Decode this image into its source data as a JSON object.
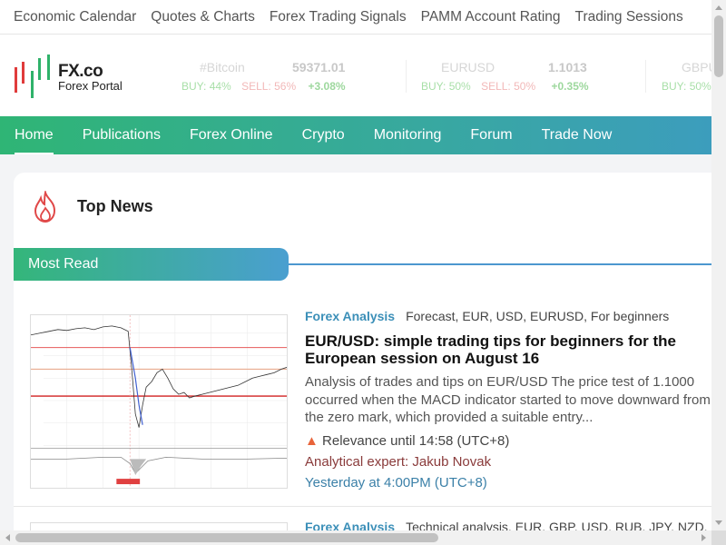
{
  "topnav": {
    "items": [
      "Economic Calendar",
      "Quotes & Charts",
      "Forex Trading Signals",
      "PAMM Account Rating",
      "Trading Sessions"
    ]
  },
  "logo": {
    "name": "FX.co",
    "tagline": "Forex Portal"
  },
  "tickers": [
    {
      "symbol": "#Bitcoin",
      "price": "59371.01",
      "buy_label": "BUY:",
      "buy": "44%",
      "sell_label": "SELL:",
      "sell": "56%",
      "change": "+3.08%"
    },
    {
      "symbol": "EURUSD",
      "price": "1.1013",
      "buy_label": "BUY:",
      "buy": "50%",
      "sell_label": "SELL:",
      "sell": "50%",
      "change": "+0.35%"
    },
    {
      "symbol": "GBPU",
      "price": "",
      "buy_label": "BUY:",
      "buy": "50%",
      "sell_label": "",
      "sell": "",
      "change": ""
    }
  ],
  "mainnav": {
    "items": [
      "Home",
      "Publications",
      "Forex Online",
      "Crypto",
      "Monitoring",
      "Forum",
      "Trade Now"
    ],
    "active": "Home"
  },
  "section": {
    "title": "Top News",
    "tab": "Most Read"
  },
  "articles": [
    {
      "category": "Forex Analysis",
      "tags": "Forecast, EUR, USD, EURUSD, For beginners",
      "headline": "EUR/USD: simple trading tips for beginners for the European session on August 16",
      "summary": "Analysis of trades and tips on EUR/USD The price test of 1.1000 occurred when the MACD indicator started to move downward from the zero mark, which provided a suitable entry...",
      "relevance": "Relevance until 14:58 (UTC+8)",
      "expert": "Analytical expert: Jakub Novak",
      "time": "Yesterday at 4:00PM (UTC+8)"
    },
    {
      "category": "Forex Analysis",
      "tags": "Technical analysis, EUR, GBP, USD, RUB, JPY, NZD, EU"
    }
  ],
  "colors": {
    "nav_gradient_start": "#2fb575",
    "nav_gradient_end": "#3c9dbd",
    "category": "#3b8fb8",
    "expert": "#8a3b3b",
    "time": "#3b80a8"
  }
}
